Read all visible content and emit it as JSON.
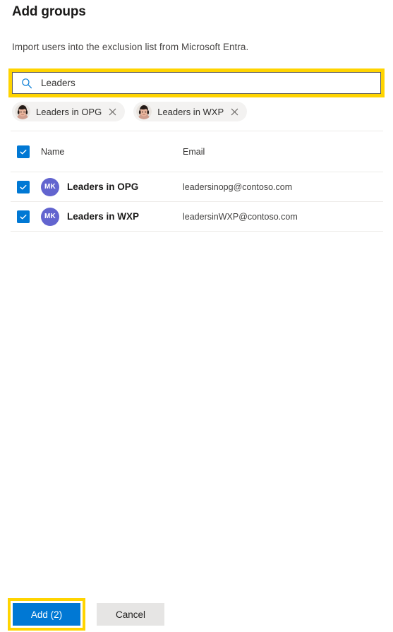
{
  "dialog": {
    "title": "Add groups",
    "subtitle": "Import users into the exclusion list from Microsoft Entra."
  },
  "search": {
    "value": "Leaders",
    "placeholder": "Search",
    "icon": "search-icon",
    "highlight_color": "#ffd400"
  },
  "chips": [
    {
      "label": "Leaders in OPG",
      "remove_icon": "close-icon"
    },
    {
      "label": "Leaders in WXP",
      "remove_icon": "close-icon"
    }
  ],
  "table": {
    "select_all_checked": true,
    "columns": [
      "Name",
      "Email"
    ],
    "rows": [
      {
        "checked": true,
        "initials": "MK",
        "name": "Leaders in OPG",
        "email": "leadersinopg@contoso.com"
      },
      {
        "checked": true,
        "initials": "MK",
        "name": "Leaders in WXP",
        "email": "leadersinWXP@contoso.com"
      }
    ]
  },
  "footer": {
    "primary_label": "Add (2)",
    "secondary_label": "Cancel",
    "primary_color": "#0078d4",
    "highlight_color": "#ffd400"
  }
}
